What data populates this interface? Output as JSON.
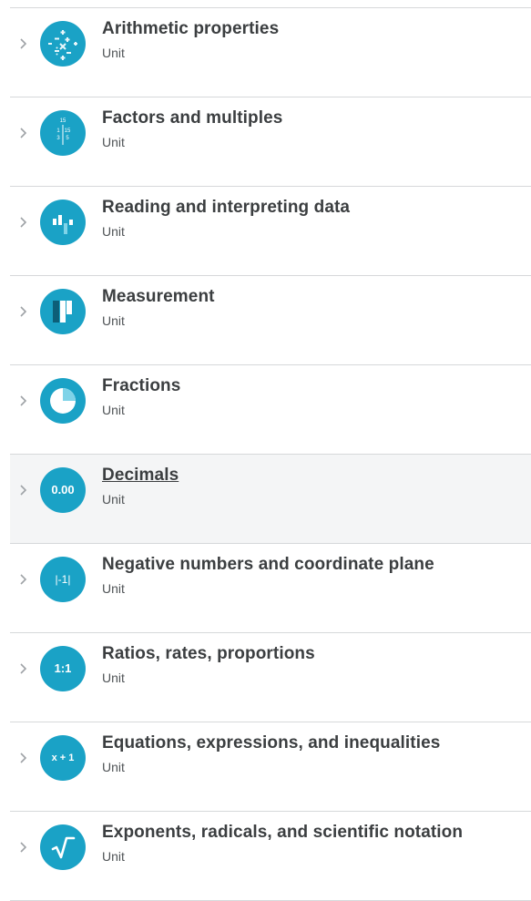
{
  "colors": {
    "icon_bg": "#1aa2c6",
    "title_text": "#3b3e40",
    "divider": "#d6d8da",
    "hover_bg": "#f4f5f6",
    "chevron": "#9ea2a6"
  },
  "units": [
    {
      "title": "Arithmetic properties",
      "subtitle": "Unit",
      "icon": "arithmetic-symbols-icon"
    },
    {
      "title": "Factors and multiples",
      "subtitle": "Unit",
      "icon": "factor-table-icon",
      "icon_text": [
        "15",
        "1",
        "15",
        "3",
        "5"
      ]
    },
    {
      "title": "Reading and interpreting data",
      "subtitle": "Unit",
      "icon": "bar-chart-icon"
    },
    {
      "title": "Measurement",
      "subtitle": "Unit",
      "icon": "measurement-bars-icon"
    },
    {
      "title": "Fractions",
      "subtitle": "Unit",
      "icon": "pie-fraction-icon"
    },
    {
      "title": "Decimals",
      "subtitle": "Unit",
      "icon": "decimal-icon",
      "icon_text": "0.00",
      "hovered": true
    },
    {
      "title": "Negative numbers and coordinate plane",
      "subtitle": "Unit",
      "icon": "absolute-value-icon",
      "icon_text": "|-1|"
    },
    {
      "title": "Ratios, rates, proportions",
      "subtitle": "Unit",
      "icon": "ratio-icon",
      "icon_text": "1:1"
    },
    {
      "title": "Equations, expressions, and inequalities",
      "subtitle": "Unit",
      "icon": "expression-icon",
      "icon_text": "x + 1"
    },
    {
      "title": "Exponents, radicals, and scientific notation",
      "subtitle": "Unit",
      "icon": "square-root-icon"
    }
  ]
}
